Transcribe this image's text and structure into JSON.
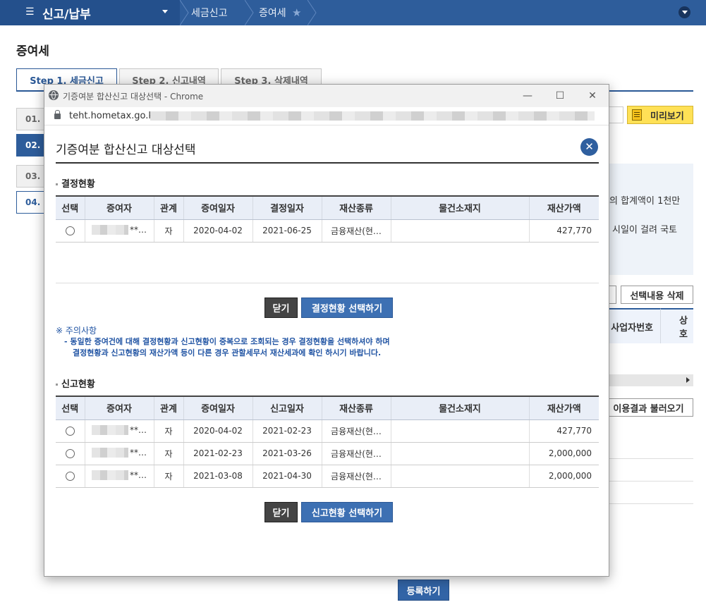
{
  "topbar": {
    "menu_label": "신고/납부",
    "crumb1": "세금신고",
    "crumb2": "증여세"
  },
  "page": {
    "title": "증여세",
    "steps": [
      "Step 1. 세금신고",
      "Step 2. 신고내역",
      "Step 3. 삭제내역"
    ],
    "side_items": [
      "01.",
      "02.",
      "03.",
      "04."
    ],
    "preview_label": "미리보기",
    "info_line1": "의 합계액이 1천만",
    "info_line2": "시일이 걸려 국토",
    "delete_selected_label": "선택내용 삭제",
    "col_bizno": "사업자번호",
    "col_trade": "상호",
    "load_result_label": "이용결과 불러오기",
    "register_label": "등록하기"
  },
  "window": {
    "title": "기증여분 합산신고 대상선택 - Chrome",
    "url": "teht.hometax.go.kr/"
  },
  "dialog": {
    "title": "기증여분 합산신고 대상선택",
    "close_icon": "close-icon"
  },
  "decision": {
    "section_title": "결정현황",
    "headers": [
      "선택",
      "증여자",
      "관계",
      "증여일자",
      "결정일자",
      "재산종류",
      "물건소재지",
      "재산가액"
    ],
    "rows": [
      {
        "donor": "**…",
        "relation": "자",
        "gift_date": "2020-04-02",
        "date2": "2021-06-25",
        "asset_type": "금융재산(현…",
        "location": "",
        "value": "427,770"
      }
    ],
    "close_label": "닫기",
    "select_label": "결정현황 선택하기"
  },
  "notice": {
    "title": "※ 주의사항",
    "line1": "- 동일한 증여건에 대해 결정현황과 신고현황이 중복으로 조회되는 경우 결정현황을 선택하셔야 하며",
    "line2": "결정현황과 신고현황의 재산가액 등이 다른 경우 관할세무서 재산세과에 확인 하시기 바랍니다."
  },
  "report": {
    "section_title": "신고현황",
    "headers": [
      "선택",
      "증여자",
      "관계",
      "증여일자",
      "신고일자",
      "재산종류",
      "물건소재지",
      "재산가액"
    ],
    "rows": [
      {
        "donor": "**…",
        "relation": "자",
        "gift_date": "2020-04-02",
        "date2": "2021-02-23",
        "asset_type": "금융재산(현…",
        "location": "",
        "value": "427,770"
      },
      {
        "donor": "**…",
        "relation": "자",
        "gift_date": "2021-02-23",
        "date2": "2021-03-26",
        "asset_type": "금융재산(현…",
        "location": "",
        "value": "2,000,000"
      },
      {
        "donor": "**…",
        "relation": "자",
        "gift_date": "2021-03-08",
        "date2": "2021-04-30",
        "asset_type": "금융재산(현…",
        "location": "",
        "value": "2,000,000"
      }
    ],
    "close_label": "닫기",
    "select_label": "신고현황 선택하기"
  }
}
